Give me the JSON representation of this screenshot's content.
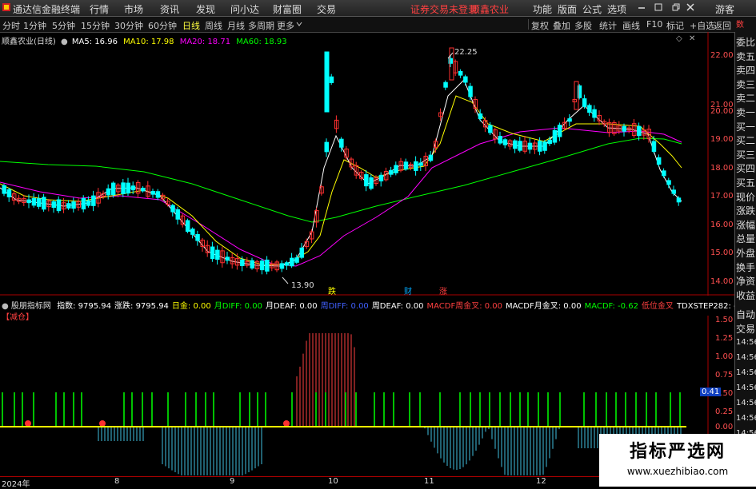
{
  "menu": {
    "app_title": "通达信金融终端",
    "items": [
      "行情",
      "市场",
      "资讯",
      "发现",
      "问小达",
      "财富圈",
      "交易"
    ],
    "login_status": "证券交易未登录",
    "current_stock": "顺鑫农业",
    "right_items": [
      "功能",
      "版面",
      "公式",
      "选项"
    ],
    "user": "游客"
  },
  "periods": {
    "items": [
      "分时",
      "1分钟",
      "5分钟",
      "15分钟",
      "30分钟",
      "60分钟",
      "日线",
      "周线",
      "月线",
      "多周期",
      "更多"
    ],
    "active": "日线",
    "tools": [
      "复权",
      "叠加",
      "多股",
      "统计",
      "画线",
      "F10",
      "标记",
      "+自选",
      "返回"
    ]
  },
  "main_chart": {
    "title": "顺鑫农业(日线)",
    "ma5": "MA5: 16.96",
    "ma10": "MA10: 17.98",
    "ma20": "MA20: 18.71",
    "ma60": "MA60: 18.93",
    "colors": {
      "ma5": "#ffffff",
      "ma10": "#ffff00",
      "ma20": "#ff00ff",
      "ma60": "#00ff00",
      "up": "#ff3030",
      "down": "#00ffff"
    },
    "high_label": "22.25",
    "low_label": "13.90",
    "signal_labels": [
      "跌",
      "财",
      "涨"
    ],
    "price_ticks": [
      "22.00",
      "21.00",
      "20.00",
      "19.00",
      "18.00",
      "17.00",
      "16.00",
      "15.00",
      "14.00"
    ],
    "icons": [
      "diamond-icon",
      "close-icon"
    ]
  },
  "indicator": {
    "name": "股朋指标网",
    "items": [
      {
        "label": "指数: 9795.94",
        "color": "#ffffff"
      },
      {
        "label": "涨跌: 9795.94",
        "color": "#ffffff"
      },
      {
        "label": "日金: 0.00",
        "color": "#ffff00"
      },
      {
        "label": "月DIFF: 0.00",
        "color": "#00ff00"
      },
      {
        "label": "月DEAF: 0.00",
        "color": "#ffffff"
      },
      {
        "label": "周DIFF: 0.00",
        "color": "#4060ff"
      },
      {
        "label": "周DEAF: 0.00",
        "color": "#ffffff"
      },
      {
        "label": "MACDF周金叉: 0.00",
        "color": "#ff4040"
      },
      {
        "label": "MACDF月金叉: 0.00",
        "color": "#ffffff"
      },
      {
        "label": "MACDF: -0.62",
        "color": "#00ff00"
      },
      {
        "label": "低位金叉",
        "color": "#ff4040"
      },
      {
        "label": "TDXSTEP282: -",
        "color": "#ffffff"
      }
    ],
    "tag": "【减仓】",
    "ticks": [
      "1.50",
      "1.25",
      "1.00",
      "0.75",
      "0.50",
      "0.25",
      "0.00"
    ],
    "current_value": "0.41"
  },
  "right_panel": {
    "top_label": "数",
    "rows": [
      "委比",
      "卖五",
      "卖四",
      "卖三",
      "卖二",
      "卖一",
      "买一",
      "买二",
      "买三",
      "买四",
      "买五",
      "现价",
      "涨跌",
      "涨幅",
      "总量",
      "外盘",
      "换手",
      "净资",
      "收益"
    ],
    "buttons": [
      "自动",
      "交易"
    ],
    "times": [
      "14:56",
      "14:56",
      "14:56",
      "14:56",
      "14:56",
      "14:56",
      "14:56",
      "14:56",
      "14:56"
    ]
  },
  "dates": [
    "2024年",
    "8",
    "9",
    "10",
    "11",
    "12"
  ],
  "watermark": {
    "title": "指标严选网",
    "url": "www.xuezhibiao.com"
  }
}
